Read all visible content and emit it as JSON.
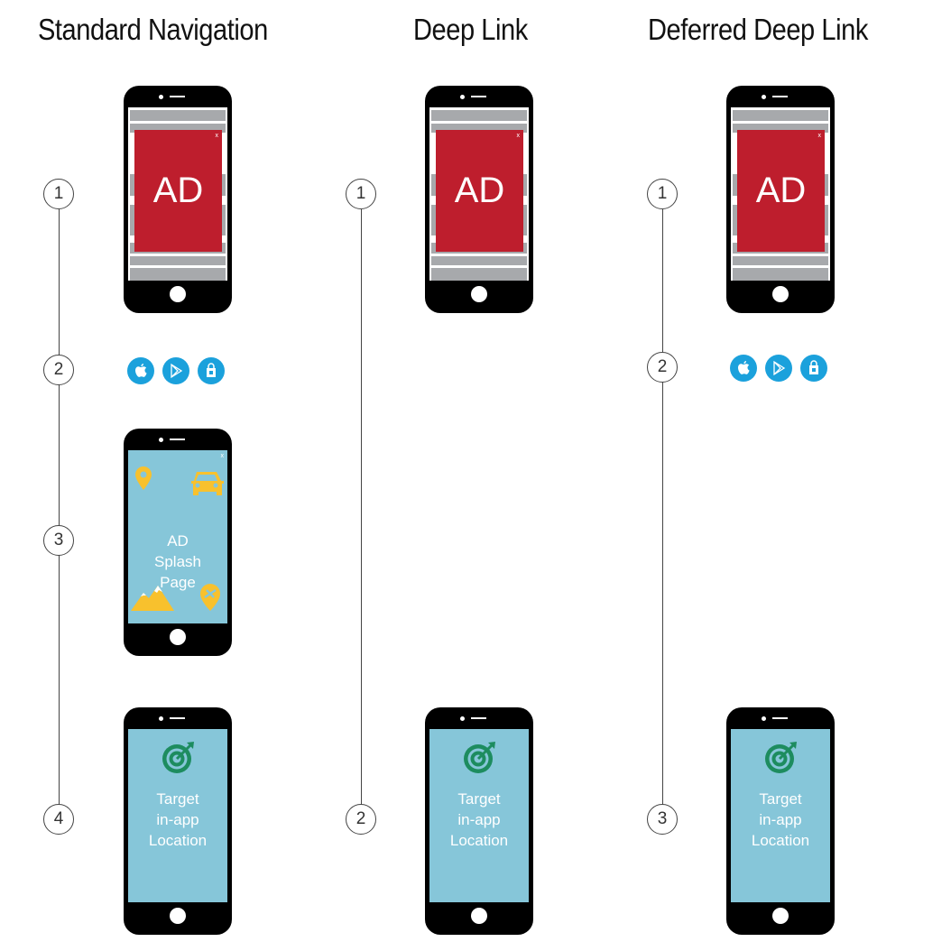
{
  "columns": [
    {
      "title": "Standard Navigation",
      "steps": [
        "1",
        "2",
        "3",
        "4"
      ]
    },
    {
      "title": "Deep Link",
      "steps": [
        "1",
        "2"
      ]
    },
    {
      "title": "Deferred Deep Link",
      "steps": [
        "1",
        "2",
        "3"
      ]
    }
  ],
  "ad_screen": {
    "label": "AD",
    "close": "x"
  },
  "splash_screen": {
    "lines": [
      "AD",
      "Splash",
      "Page"
    ],
    "close": "x"
  },
  "target_screen": {
    "lines": [
      "Target",
      "in-app",
      "Location"
    ]
  },
  "app_stores": [
    "apple-app-store",
    "google-play",
    "windows-store"
  ],
  "colors": {
    "ad_red": "#be1e2d",
    "screen_blue": "#86c6d9",
    "store_blue": "#1ba1dc",
    "icon_yellow": "#f8c12d",
    "target_green": "#1d8c5f"
  }
}
